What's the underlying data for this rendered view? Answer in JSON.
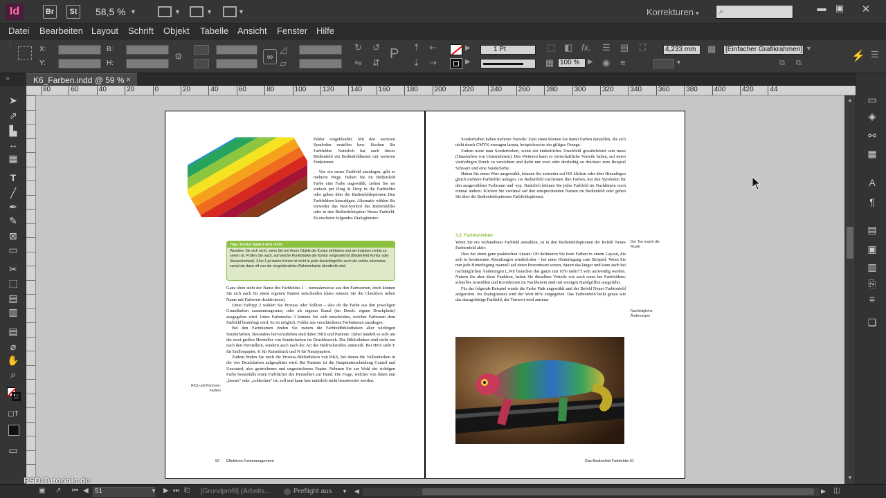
{
  "app": {
    "logo": "Id",
    "bridge_btn": "Br",
    "stock_btn": "St",
    "zoom": "58,5 %",
    "workspace": "Korrekturen",
    "logo_icon": "indesign-logo-icon"
  },
  "menu": [
    "Datei",
    "Bearbeiten",
    "Layout",
    "Schrift",
    "Objekt",
    "Tabelle",
    "Ansicht",
    "Fenster",
    "Hilfe"
  ],
  "control": {
    "x_label": "X:",
    "y_label": "Y:",
    "b_label": "B:",
    "h_label": "H:",
    "stroke_weight": "1 Pt",
    "opacity": "100 %",
    "offset": "4,233 mm",
    "object_style": "[Einfacher Grafikrahmen]"
  },
  "tab": {
    "title": "K6_Farben.indd @ 59 %",
    "close": "×"
  },
  "ruler_labels": [
    "80",
    "60",
    "40",
    "20",
    "0",
    "20",
    "40",
    "60",
    "80",
    "100",
    "120",
    "140",
    "160",
    "180",
    "200",
    "220",
    "240",
    "260",
    "280",
    "300",
    "320",
    "340",
    "360",
    "380",
    "400",
    "420",
    "44"
  ],
  "left_page": {
    "intro": "Felder eingeblendet. Mit den weiteren Symbolen erstellen bzw. löschen Sie Farbfelder. Natürlich hat auch dieses Bedienfeld ein Bedienfeldmenü mit weiteren Funktionen.",
    "para1": "Um ein neues Farbfeld anzulegen, gibt es mehrere Wege. Haben Sie im Bedienfeld Farbe eine Farbe angewählt, ziehen Sie sie einfach per Drag & Drop in die Farbfelder oder gehen über die Bedienfeldoptionen Den Farbfeldern hinzufügen. Alternativ wählen Sie entweder das Neu-Symbol des Bedienfeldes oder in den Bedienfeldoption Neues Farbfeld. Es erscheint folgendes Dialogfenster:",
    "tip_title": "Tipp: Kontur ändert sich nicht",
    "tip_text": "Wundern Sie sich nicht, wenn Sie bei Ihrem Objekt die Kontur einfärben und sie trotzdem nichts zu sehen ist. Prüfen Sie nach, auf welche Punktstärke die Kontur eingestellt ist (Bedienfeld Kontur oder Steuerelement). Eine 1 pt starke Kontur ist nicht in jeder Ansichtsgröße auch als solche erkennbar, zumal sie dann oft von der eingeblendeten Rahmenkante überdeckt wird.",
    "para2": "Ganz oben steht der Name des Farbfeldes 1 – normalerweise aus den Farbwerten, doch können Sie sich auch für einen eigenen Namen entscheiden (dazu müssen Sie die Checkbox neben Name mit Farbwert deaktivieren).",
    "para3": "Unter Farbtyp 2 wählen Sie Prozess oder Vollton – also ob die Farbe aus den jeweiligen Grundfarben zusammengesetzt, oder als eigener Kanal (im Druck: eigene Druckplatte) ausgegeben wird. Unter Farbmodus 3 können Sie sich entscheiden, welcher Farbraum dem Farbfeld hinterlegt wird. Es ist möglich, Folder aus verschiedenen Farbräumen anzulegen.",
    "para4": "Bei den Farbräumen finden Sie zudem die Farbfeldbibliotheken aller wichtigen Sonderfarben. Besonders hervorzuheben sind dabei HKS und Pantone. Dabei handelt es sich um die zwei großen Hersteller von Sonderfarben im Druckbereich. Die Bibliotheken sind nicht nur nach den Herstellern, sondern auch nach der Art des Bedruckstoffes unterteilt. Bei HKS steht E für Endlospapier, K für Kunstdruck und N für Naturpapiere.",
    "para5": "Zudem finden Sie noch die Prozess-Bibliotheken von HKS, bei denen die Volltonfarben in die vier Druckfarben aufgesplittet wird. Bei Pantone ist die Hauptunterscheidung Coated und Uncoated, also gestrichenes und ungestrichenes Papier. Nehmen Sie zur Wahl der richtigen Farbe bestenfalls einen Farbfächer des Herstellers zur Hand. Die Frage, welcher von ihnen nun „besser\" oder „schlechter\" ist, soll und kann hier natürlich nicht beantwortet werden.",
    "margin_note": "HKS und Pantone-Farben",
    "footer_num": "50",
    "footer_title": "Effektives Farbmanagement"
  },
  "right_page": {
    "para1": "Sonderfarben haben mehrere Vorteile: Zum einen können Sie damit Farben darstellen, die sich nicht durch CMYK erzeugen lassen, beispielsweise ein giftiges Orange.",
    "para2": "Zudem nutzt man Sonderfarben, wenn ein einheitliches Druckbild gewährleistet sein muss (Hausfarben von Unternehmen). Des Weiteren kann es wirtschaftliche Vorteile haben, auf einen vierfarbigen Druck zu verzichten und dafür nur zwei oder dreifarbig zu drucken: zum Beispiel Schwarz und eine Sonderfarbe.",
    "para3": "Haben Sie einen Wert ausgewählt, können Sie entweder auf OK klicken oder über Hinzufügen gleich mehrere Farbfelder anlegen. Im Bedienfeld erscheinen Ihre Farben, mit den Symbolen für den ausgewählten Farbraum und -typ. Natürlich können Sie jedes Farbfeld im Nachhinein noch einmal ändern: Klicken Sie zweimal auf den entsprechenden Namen im Bedienfeld oder gehen Sie über die Bedienfeldoptionen Farbfeldoptionen.",
    "heading": "3.2. Farbtonfelder",
    "para4": "Wenn Sie ein vorhandenes Farbfeld anwählen, ist in den Bedienfeldoptionen der Befehl Neues Farbtonfeld aktiv.",
    "para5": "Dies hat einen ganz praktischen Ansatz: Oft definieren Sie feste Farben in einem Layout, die sich in bestimmten Abstufungen wiederholen – bei einer Hinterlegung zum Beispiel. Wenn Sie nun jede Hinterlegung manuell auf einen Prozentwert setzen, dauert das länger und kann auch bei nachträglichen Änderungen („Wir brauchen das ganze mit 10% mehr!\") sehr aufwendig werden. Nutzen Sie aber diese Funktion, haben Sie dieselben Vorteile wie auch sonst bei Farbfeldern: schnelles Anwählen und Korrekturen im Nachhinein sind mit wenigen Handgriffen ausgeführt.",
    "para6": "Für das folgende Beispiel wurde die Farbe Pink angewählt und der Befehl Neues Farbtonfeld aufgerufen. Im Dialogfenster wird der Wert 80% eingegeben. Das Farbtonfeld heißt genau wie das dazugehörige Farbfeld, der Tonwert wird automa-",
    "margin_note1": "Der Ton macht die Musik",
    "margin_note2": "Nachträgliche Änderungen",
    "footer_title": "Das Bedienfeld Farbfelder",
    "footer_num": "51"
  },
  "status": {
    "page": "51",
    "profile": "[Grundprofil] (Arbeits...",
    "preflight": "Preflight aus"
  },
  "watermark": "PSD-Tutorials.de",
  "colors": {
    "accent_green": "#8cc23f",
    "tip_bg": "#dde9c8",
    "canvas": "#c6c6c6"
  }
}
